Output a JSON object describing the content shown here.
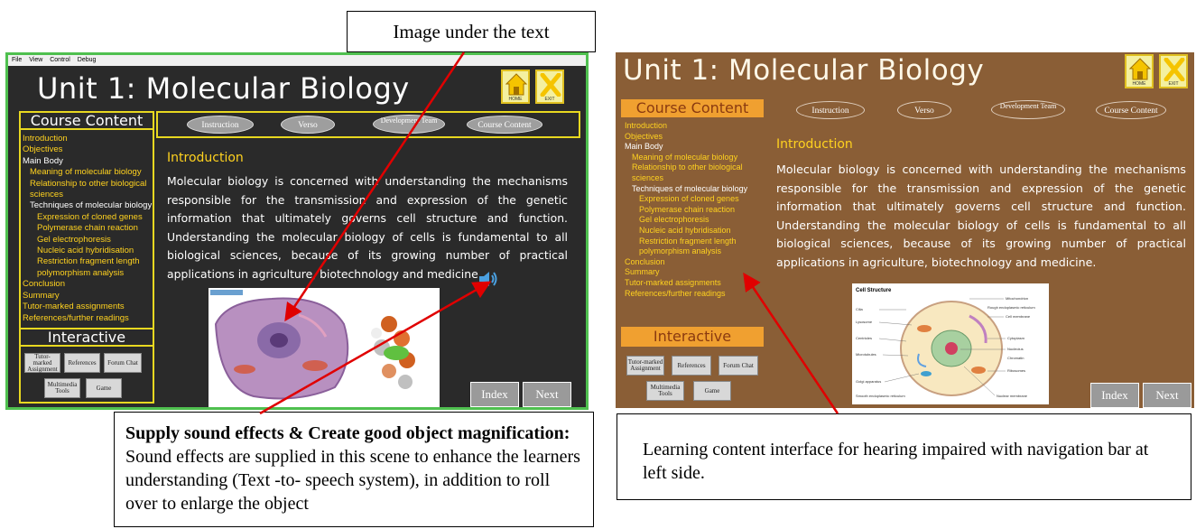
{
  "callouts": {
    "top": "Image under the text",
    "left_bold": "Supply sound effects & Create good object magnification:",
    "left_text": "Sound effects are supplied in this scene to enhance the learners understanding (Text -to- speech system), in addition to roll over to enlarge the object",
    "right": "Learning content interface for hearing impaired with navigation bar at left side."
  },
  "menubar": [
    "File",
    "View",
    "Control",
    "Debug"
  ],
  "unit_title": "Unit 1: Molecular Biology",
  "home_label": "HOME",
  "exit_label": "EXIT",
  "course_content_heading": "Course Content",
  "interactive_heading": "Interactive",
  "nav_items": [
    "Introduction",
    "Objectives",
    "Main Body",
    "Meaning of molecular biology",
    "Relationship to other biological",
    "sciences",
    "Techniques of molecular biology",
    "Expression of cloned genes",
    "Polymerase chain reaction",
    "Gel electrophoresis",
    "Nucleic acid hybridisation",
    "Restriction fragment length",
    "polymorphism analysis",
    "Conclusion",
    "Summary",
    "Tutor-marked assignments",
    "References/further readings"
  ],
  "top_tabs": [
    "Instruction",
    "Verso",
    "Development Team",
    "Course Content"
  ],
  "interactive_buttons": [
    "Tutor-marked Assignment",
    "References",
    "Forum Chat",
    "Multimedia Tools",
    "Game"
  ],
  "content_heading": "Introduction",
  "content_text": "Molecular biology is concerned with understanding the mechanisms responsible for the transmission and expression of the genetic information that ultimately governs cell structure and function. Understanding the molecular biology of cells is fundamental to all biological sciences, because of its growing number of practical applications in agriculture, biotechnology and medicine.",
  "index_label": "Index",
  "next_label": "Next",
  "figure_title": "Cell Structure",
  "figure_labels": [
    "Mitochondrion",
    "Rough endoplasmic reticulum",
    "Cell membrane",
    "Cytoplasm",
    "Nucleolus",
    "Chromatin",
    "Ribosomes",
    "Nuclear membrane",
    "Cilia",
    "Lysosome",
    "Centrioles",
    "Microtubules",
    "Golgi apparatus",
    "Smooth endoplasmic reticulum"
  ],
  "colors": {
    "left_bg": "#2a2a2a",
    "right_bg": "#8a5e36",
    "accent_yellow": "#ffd21f",
    "panel_orange": "#f0a030",
    "arrow_red": "#e00000"
  }
}
